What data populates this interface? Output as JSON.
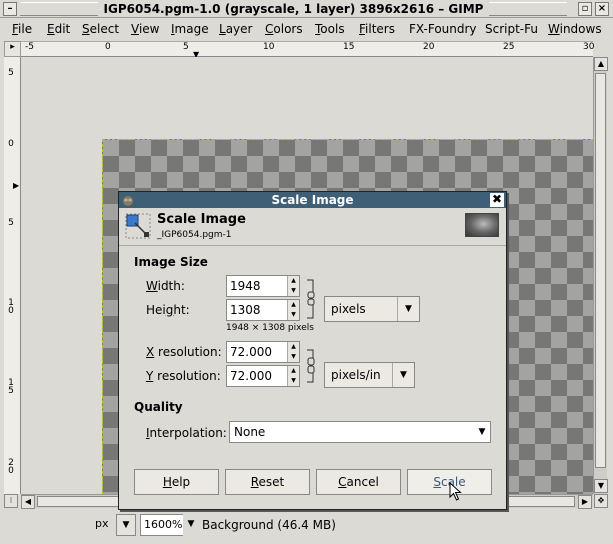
{
  "window": {
    "title": "IGP6054.pgm-1.0 (grayscale, 1 layer) 3896x2616 – GIMP"
  },
  "menu": [
    "File",
    "Edit",
    "Select",
    "View",
    "Image",
    "Layer",
    "Colors",
    "Tools",
    "Filters",
    "FX-Foundry",
    "Script-Fu",
    "Windows"
  ],
  "hruler": [
    "-5",
    "0",
    "5",
    "10",
    "15",
    "20",
    "25",
    "30"
  ],
  "vruler": [
    "5",
    "0",
    "5",
    "1 0",
    "1 5",
    "2 0"
  ],
  "dialog": {
    "title": "Scale Image",
    "header_title": "Scale Image",
    "header_subtitle": "_IGP6054.pgm-1",
    "image_size_label": "Image Size",
    "width_label": "Width:",
    "width_value": "1948",
    "height_label": "Height:",
    "height_value": "1308",
    "size_unit": "pixels",
    "size_info": "1948 × 1308 pixels",
    "xres_label": "X resolution:",
    "xres_value": "72.000",
    "yres_label": "Y resolution:",
    "yres_value": "72.000",
    "res_unit": "pixels/in",
    "quality_label": "Quality",
    "interp_label": "Interpolation:",
    "interp_value": "None",
    "buttons": {
      "help": "Help",
      "reset": "Reset",
      "cancel": "Cancel",
      "scale": "Scale"
    }
  },
  "status": {
    "unit": "px",
    "zoom": "1600%",
    "layer_info": "Background (46.4 MB)"
  },
  "colors": {
    "dialog_title_bg": "#3e5f75",
    "selection": "#c8b400"
  }
}
